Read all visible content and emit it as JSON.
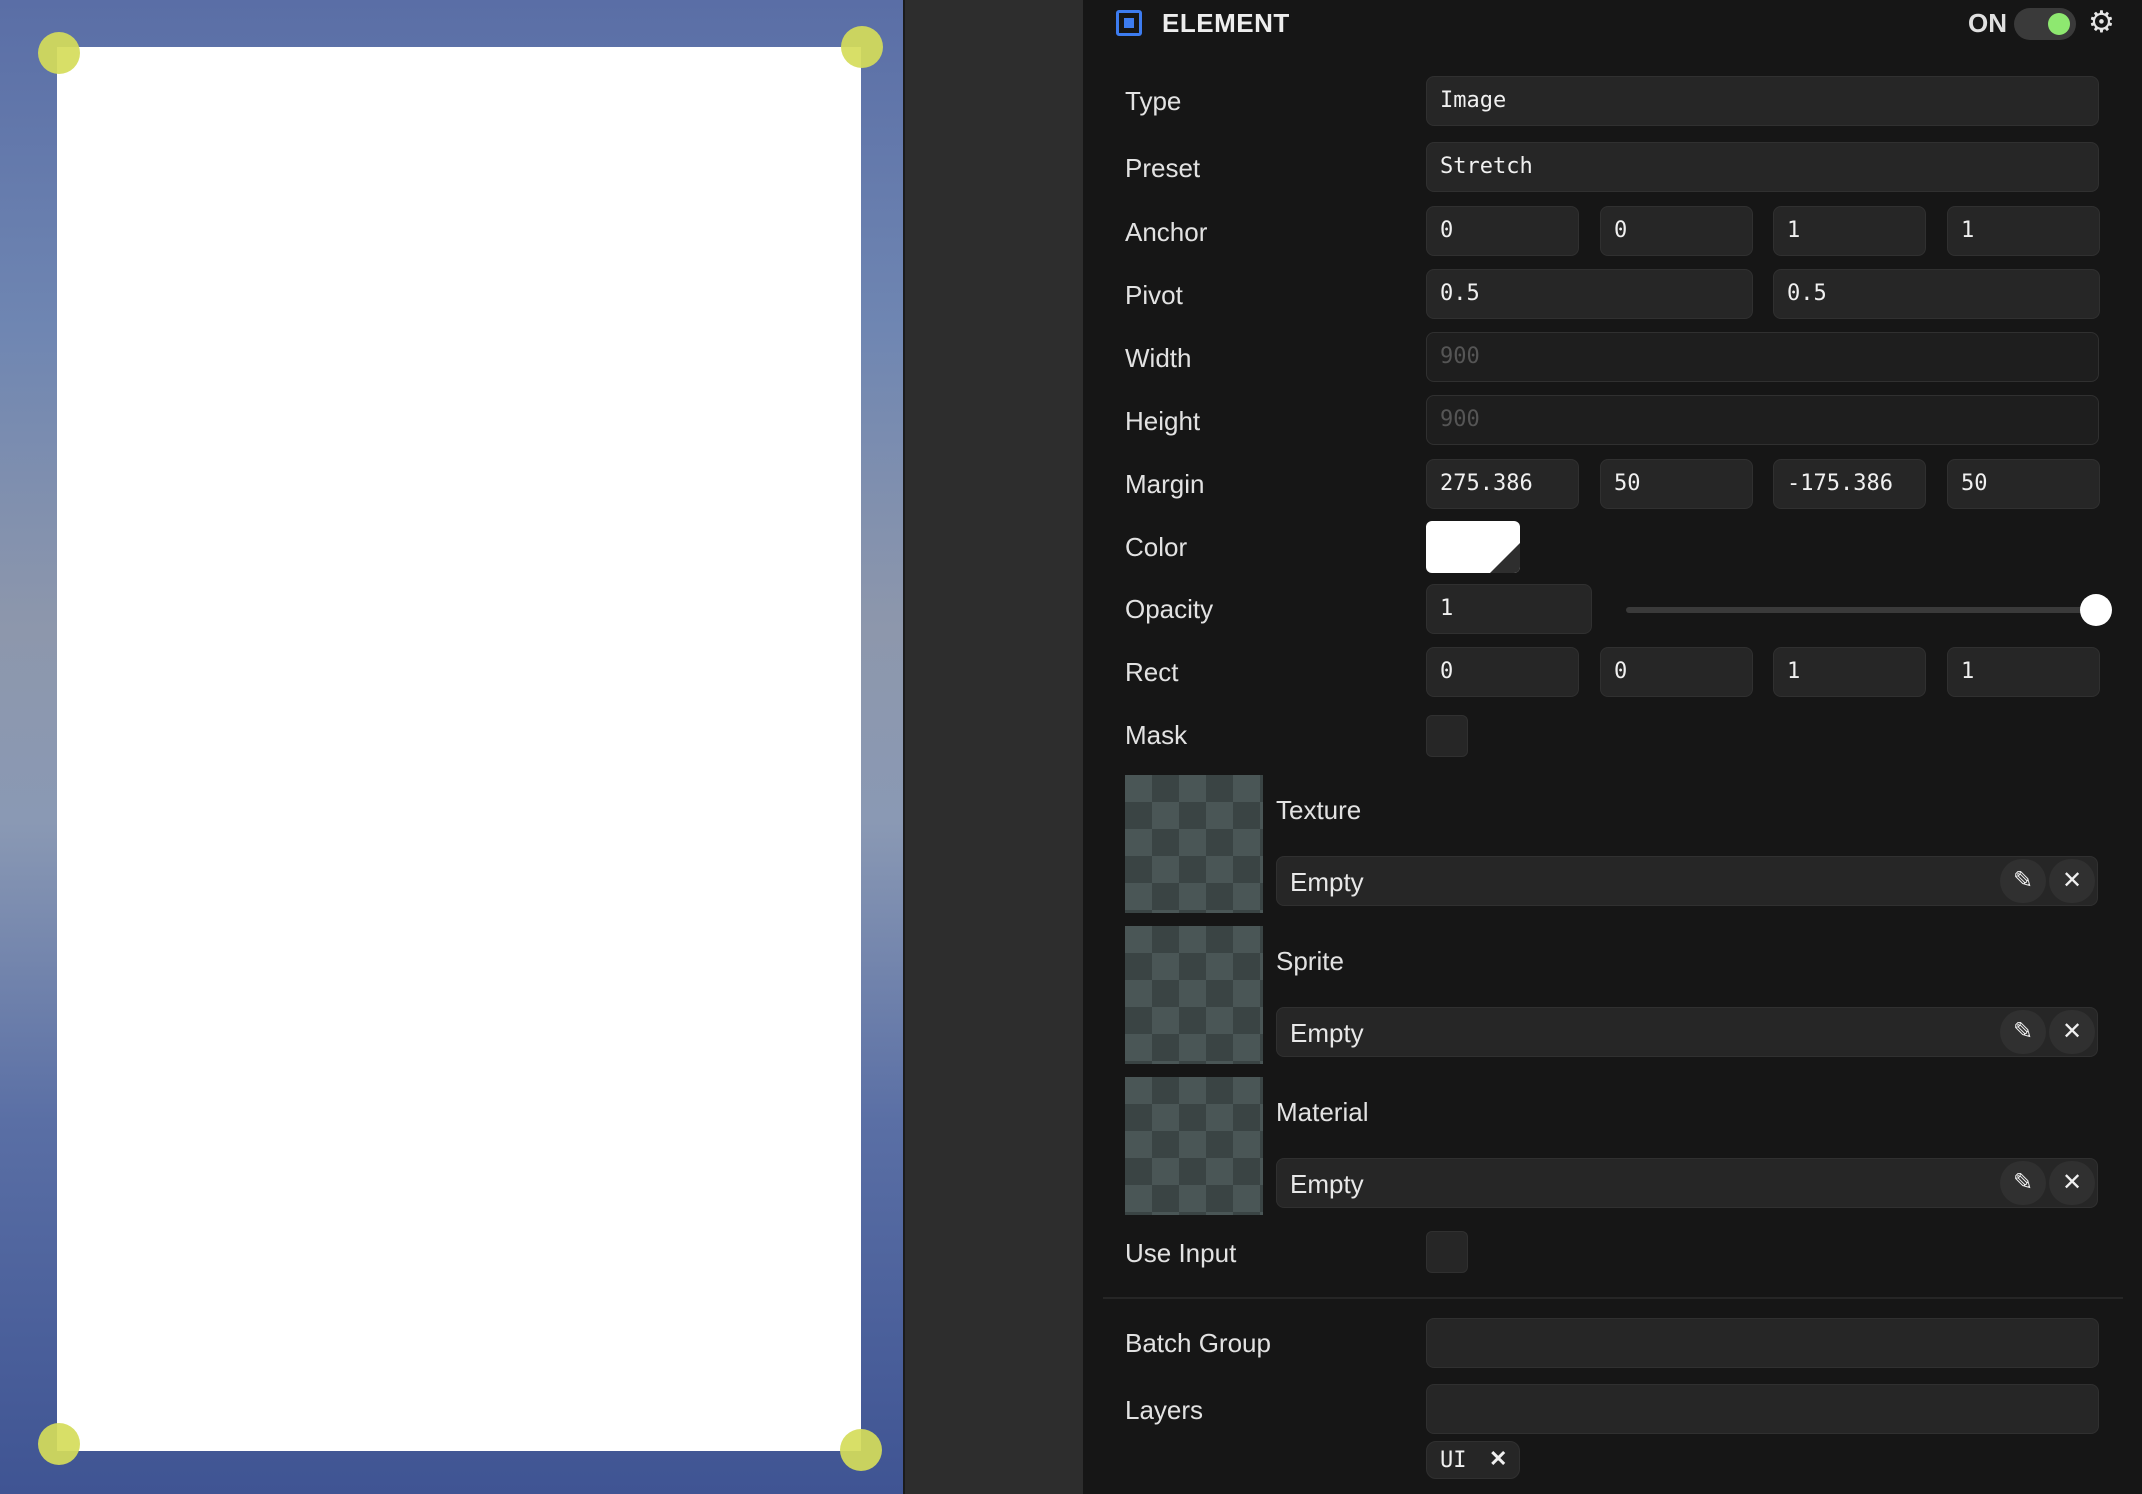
{
  "inspector": {
    "title": "ELEMENT",
    "enabled_label": "ON",
    "enabled": true,
    "accent_color": "#3d7cf0",
    "toggle_color": "#8ee870",
    "icons": {
      "component": "element-square-icon",
      "settings": "gear-icon",
      "edit": "pencil-icon",
      "remove": "close-icon"
    }
  },
  "fields": {
    "type": {
      "label": "Type",
      "value": "Image"
    },
    "preset": {
      "label": "Preset",
      "value": "Stretch"
    },
    "anchor": {
      "label": "Anchor",
      "values": [
        "0",
        "0",
        "1",
        "1"
      ]
    },
    "pivot": {
      "label": "Pivot",
      "values": [
        "0.5",
        "0.5"
      ]
    },
    "width": {
      "label": "Width",
      "value": "900"
    },
    "height": {
      "label": "Height",
      "value": "900"
    },
    "margin": {
      "label": "Margin",
      "values": [
        "275.386",
        "50",
        "-175.386",
        "50"
      ]
    },
    "color": {
      "label": "Color",
      "value": "#ffffff"
    },
    "opacity": {
      "label": "Opacity",
      "value": "1",
      "slider_level": 1.0
    },
    "rect": {
      "label": "Rect",
      "values": [
        "0",
        "0",
        "1",
        "1"
      ]
    },
    "mask": {
      "label": "Mask",
      "checked": false
    },
    "texture": {
      "label": "Texture",
      "value": "Empty"
    },
    "sprite": {
      "label": "Sprite",
      "value": "Empty"
    },
    "material": {
      "label": "Material",
      "value": "Empty"
    },
    "use_input": {
      "label": "Use Input",
      "checked": false
    },
    "batch_group": {
      "label": "Batch Group",
      "value": ""
    },
    "layers": {
      "label": "Layers",
      "value": "",
      "tags": [
        "UI"
      ]
    }
  }
}
